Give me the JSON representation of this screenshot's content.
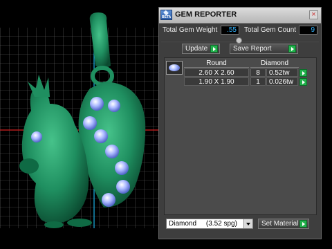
{
  "panel": {
    "title": "GEM REPORTER",
    "close_glyph": "×",
    "app_icon_text": "BETA",
    "total_weight_label": "Total Gem Weight",
    "total_weight_value": ".55",
    "total_count_label": "Total Gem Count",
    "total_count_value": "9",
    "update_label": "Update",
    "save_report_label": "Save Report",
    "table": {
      "columns": [
        "Round",
        "Diamond"
      ],
      "rows": [
        {
          "size": "2.60 X 2.60",
          "count": "8",
          "weight": "0.52tw"
        },
        {
          "size": "1.90 X 1.90",
          "count": "1",
          "weight": "0.026tw"
        }
      ]
    },
    "material": {
      "selected": "Diamond     (3.52 spg)"
    },
    "set_material_label": "Set Material"
  },
  "icons": {
    "app": "gem-reporter-app-icon",
    "close": "close-icon",
    "go": "green-arrow-icon",
    "shape": "round-gem-shape-icon",
    "dropdown": "chevron-down-icon"
  },
  "colors": {
    "viewport_bg": "#000000",
    "grid_line": "#7a7a7a",
    "axis_red": "#d62020",
    "axis_cyan": "#1ab4e8",
    "model_green": "#1f8f60",
    "gem_blue": "#aab8ff",
    "panel_bg": "#3e3e3e",
    "value_text": "#36b6ff",
    "go_green": "#22b14c"
  }
}
